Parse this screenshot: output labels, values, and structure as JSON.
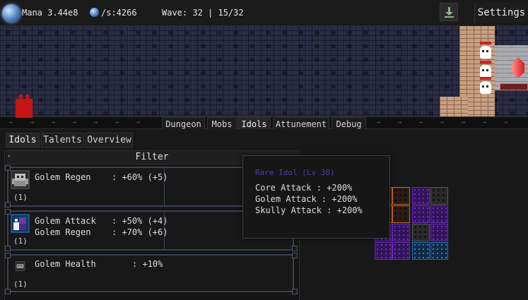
{
  "topbar": {
    "mana_label": "Mana 3.44e8",
    "rate_label": "/s:4266",
    "wave_label": "Wave: 32 | 15/32",
    "settings_label": "Settings",
    "icons": {
      "mana": "mana-orb-icon",
      "rate": "mana-orb-icon",
      "download": "download-icon"
    }
  },
  "main_tabs": [
    {
      "label": "Dungeon",
      "active": false
    },
    {
      "label": "Mobs",
      "active": false
    },
    {
      "label": "Idols",
      "active": true
    },
    {
      "label": "Attunement",
      "active": false
    },
    {
      "label": "Debug",
      "active": false
    }
  ],
  "rail_arrow": "→",
  "sub_tabs": [
    {
      "label": "Idols",
      "active": true
    },
    {
      "label": "Talents",
      "active": false
    },
    {
      "label": "Overview",
      "active": false
    }
  ],
  "filter_label": "Filter",
  "idols": [
    {
      "icon": "golem-regen-idol-icon",
      "count": "(1)",
      "stats": [
        {
          "name": "Golem Regen",
          "value": ": +60% (+5)"
        }
      ]
    },
    {
      "icon": "golem-attack-idol-icon",
      "count": "(1)",
      "stats": [
        {
          "name": "Golem Attack",
          "value": ": +50% (+4)"
        },
        {
          "name": "Golem Regen",
          "value": ": +70% (+6)"
        }
      ]
    },
    {
      "icon": "golem-health-idol-icon",
      "count": "(1)",
      "stats": [
        {
          "name": "Golem Health",
          "value": ": +10%"
        }
      ]
    }
  ],
  "tooltip": {
    "title": "Rare Idol (Lv 30)",
    "lines": [
      "Core Attack : +200%",
      "Golem Attack : +200%",
      "Skully Attack : +200%"
    ]
  },
  "colors": {
    "core": "#c41414",
    "tooltip_title": "#4c3fa6",
    "grid_orange": "#c9682a",
    "grid_purple": "#6a2bb8",
    "grid_blue": "#1f6eb5"
  }
}
